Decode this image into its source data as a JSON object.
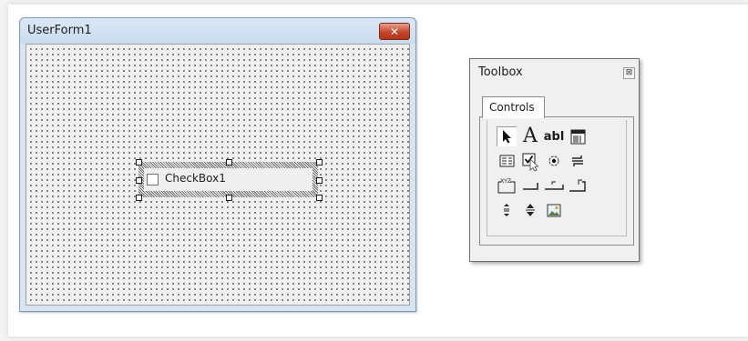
{
  "userform": {
    "title": "UserForm1",
    "close_label": "✕",
    "checkbox": {
      "label": "CheckBox1",
      "checked": false
    }
  },
  "toolbox": {
    "title": "Toolbox",
    "close_label": "⊠",
    "tabs": [
      {
        "label": "Controls",
        "active": true
      }
    ],
    "tools": [
      {
        "icon": "select-objects-icon",
        "selected": true
      },
      {
        "icon": "label-icon",
        "glyph": "A"
      },
      {
        "icon": "textbox-icon",
        "glyph": "abl"
      },
      {
        "icon": "combobox-icon"
      },
      {
        "icon": "listbox-icon"
      },
      {
        "icon": "checkbox-icon",
        "hovered": true
      },
      {
        "icon": "optionbutton-icon"
      },
      {
        "icon": "togglebutton-icon"
      },
      {
        "icon": "frame-icon",
        "glyph": "XYZ"
      },
      {
        "icon": "commandbutton-icon"
      },
      {
        "icon": "tabstrip-icon"
      },
      {
        "icon": "multipage-icon"
      },
      {
        "icon": "scrollbar-icon"
      },
      {
        "icon": "spinbutton-icon"
      },
      {
        "icon": "image-icon"
      }
    ]
  },
  "colors": {
    "close_button": "#c8452c",
    "window_frame": "#d7e4f2",
    "form_background": "#f0f0f0"
  }
}
